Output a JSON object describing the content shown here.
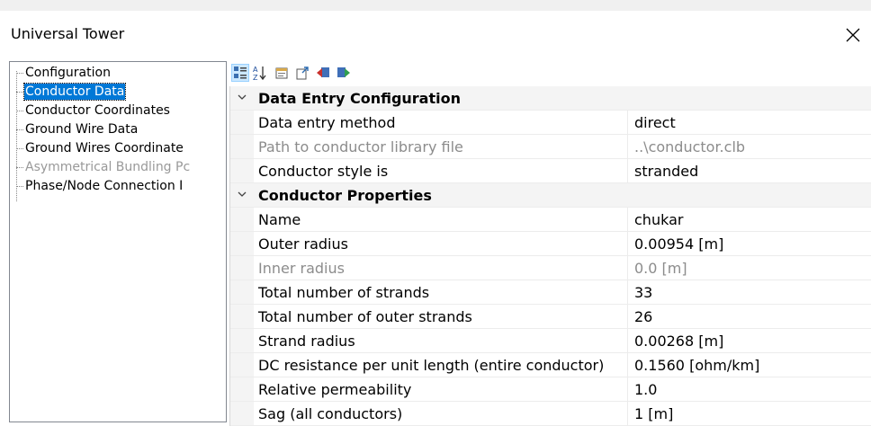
{
  "window": {
    "title": "Universal Tower"
  },
  "tree": {
    "items": [
      {
        "label": "Configuration",
        "selected": false,
        "disabled": false
      },
      {
        "label": "Conductor Data",
        "selected": true,
        "disabled": false
      },
      {
        "label": "Conductor Coordinates",
        "selected": false,
        "disabled": false
      },
      {
        "label": "Ground Wire Data",
        "selected": false,
        "disabled": false
      },
      {
        "label": "Ground Wires Coordinate",
        "selected": false,
        "disabled": false
      },
      {
        "label": "Asymmetrical Bundling Pc",
        "selected": false,
        "disabled": true
      },
      {
        "label": "Phase/Node Connection I",
        "selected": false,
        "disabled": false
      }
    ]
  },
  "toolbar": {
    "buttons": [
      "categorized-icon",
      "alphabetical-sort-icon",
      "property-pages-icon",
      "export-icon",
      "load-icon",
      "save-icon"
    ]
  },
  "grid": {
    "categories": [
      {
        "name": "Data Entry Configuration",
        "properties": [
          {
            "name": "Data entry method",
            "value": "direct",
            "disabled": false
          },
          {
            "name": "Path to conductor library file",
            "value": "..\\conductor.clb",
            "disabled": true
          },
          {
            "name": "Conductor style is",
            "value": "stranded",
            "disabled": false
          }
        ]
      },
      {
        "name": "Conductor Properties",
        "properties": [
          {
            "name": "Name",
            "value": "chukar",
            "disabled": false
          },
          {
            "name": "Outer radius",
            "value": "0.00954 [m]",
            "disabled": false
          },
          {
            "name": "Inner radius",
            "value": "0.0 [m]",
            "disabled": true
          },
          {
            "name": "Total number of strands",
            "value": "33",
            "disabled": false
          },
          {
            "name": "Total number of outer strands",
            "value": "26",
            "disabled": false
          },
          {
            "name": "Strand radius",
            "value": "0.00268 [m]",
            "disabled": false
          },
          {
            "name": "DC resistance per unit length (entire conductor)",
            "value": "0.1560 [ohm/km]",
            "disabled": false
          },
          {
            "name": "Relative permeability",
            "value": "1.0",
            "disabled": false
          },
          {
            "name": "Sag (all conductors)",
            "value": "1 [m]",
            "disabled": false
          }
        ]
      }
    ]
  },
  "colors": {
    "selection": "#0078d7",
    "category_bg": "#f4f4f4",
    "disabled_text": "#8c8c8c"
  }
}
